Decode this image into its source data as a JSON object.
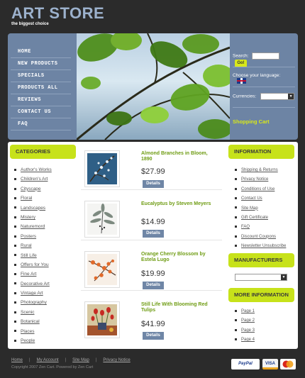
{
  "header": {
    "title": "ART STORE",
    "tagline": "the biggest choice"
  },
  "nav": [
    "HOME",
    "NEW PRODUCTS",
    "SPECIALS",
    "PRODUCTS ALL",
    "REVIEWS",
    "CONTACT US",
    "FAQ"
  ],
  "rightbox": {
    "search_label": "Search:",
    "go_label": "Go!",
    "language_label": "Choose your language:",
    "language_flag_icon": "uk-flag-icon",
    "currencies_label": "Currencies:",
    "cart_label": "Shopping Cart"
  },
  "categories": {
    "heading": "CATEGORIES",
    "items": [
      "Author's Works",
      "Children's Art",
      "Cityscape",
      "Floral",
      "Landscapes",
      "Mistery",
      "Naturemord",
      "Posters",
      "Rural",
      "Still Life",
      "Offers for You",
      "Fine Art",
      "Decorative Art",
      "Vintage Art",
      "Photography",
      "Scenic",
      "Botanical",
      "Places",
      "People"
    ]
  },
  "products": [
    {
      "name": "Almond Branches in Bloom, 1890",
      "price": "$27.99",
      "button": "Details"
    },
    {
      "name": "Eucalyptus by Steven Meyers",
      "price": "$14.99",
      "button": "Details"
    },
    {
      "name": "Orange Cherry Blossom by Estela Lugo",
      "price": "$19.99",
      "button": "Details"
    },
    {
      "name": "Still Life With Blooming Red Tulips",
      "price": "$41.99",
      "button": "Details"
    }
  ],
  "information": {
    "heading": "INFORMATION",
    "items": [
      "Shipping & Returns",
      "Privacy Notice",
      "Conditions of Use",
      "Contact Us",
      "Site Map",
      "Gift Certificate",
      "FAQ",
      "Discount Coupons",
      "Newsletter Unsubscribe"
    ]
  },
  "manufacturers": {
    "heading": "MANUFACTURERS"
  },
  "more_information": {
    "heading": "MORE INFORMATION",
    "items": [
      "Page 1",
      "Page 2",
      "Page 3",
      "Page 4"
    ]
  },
  "footer": {
    "links": [
      "Home",
      "My Account",
      "Site Map",
      "Privacy Notice"
    ],
    "copyright": "Copyright   2007 Zen Cart. Powered by Zen Cart",
    "payments": [
      "PayPal",
      "VISA",
      "MasterCard"
    ]
  },
  "colors": {
    "accent": "#c7e21a",
    "menu_bg": "#6d84a4",
    "product_name": "#6f9c13",
    "page_bg": "#2b2b2b"
  }
}
